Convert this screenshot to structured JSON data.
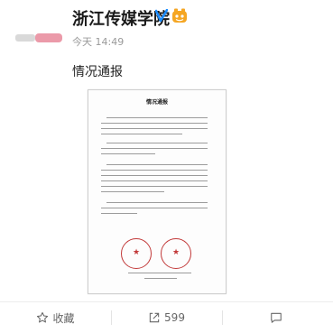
{
  "post": {
    "author": "浙江传媒学院",
    "time": "今天 14:49",
    "text": "情况通报",
    "verified_color": "#1a8cff",
    "badge_color": "#f5a623"
  },
  "document": {
    "title": "情况通报",
    "seal_color": "#c23a3a"
  },
  "actions": {
    "favorite_label": "收藏",
    "repost_count": "599"
  }
}
